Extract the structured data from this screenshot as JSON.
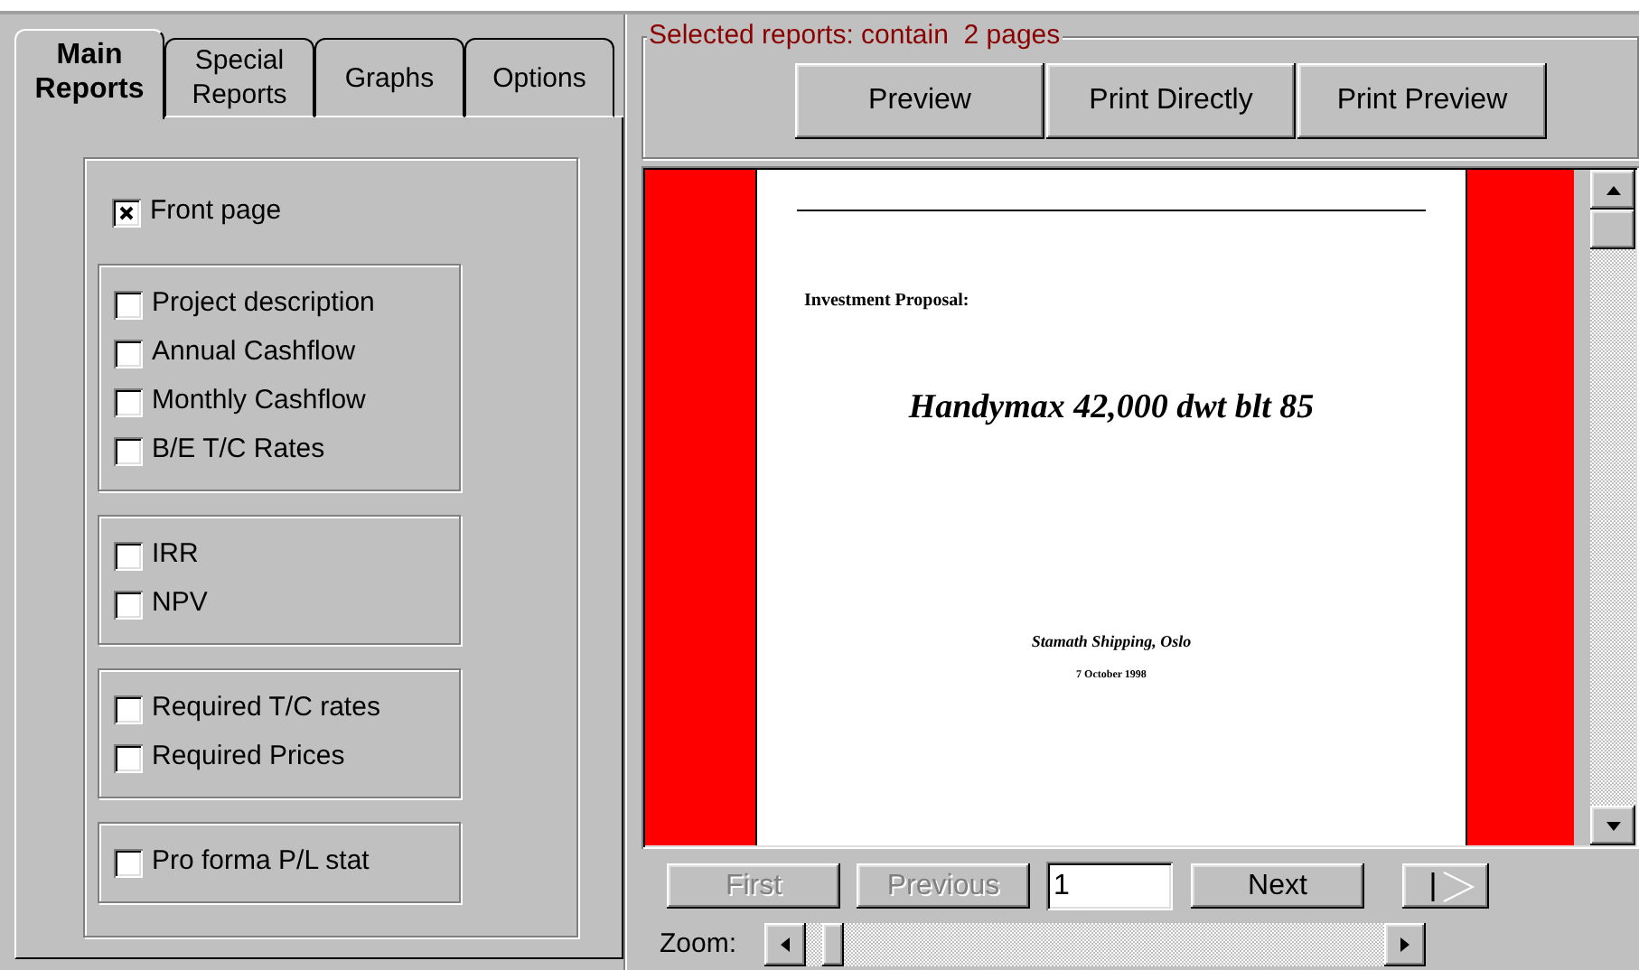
{
  "tabs": [
    {
      "label": "Main Reports",
      "selected": true
    },
    {
      "label": "Special Reports",
      "selected": false
    },
    {
      "label": "Graphs",
      "selected": false
    },
    {
      "label": "Options",
      "selected": false
    }
  ],
  "report_groups": [
    {
      "kind": "plain",
      "items": [
        {
          "label": "Front page",
          "checked": true
        }
      ]
    },
    {
      "kind": "boxed",
      "items": [
        {
          "label": "Project description",
          "checked": false
        },
        {
          "label": "Annual Cashflow",
          "checked": false
        },
        {
          "label": "Monthly Cashflow",
          "checked": false
        },
        {
          "label": "B/E T/C Rates",
          "checked": false
        }
      ]
    },
    {
      "kind": "boxed",
      "items": [
        {
          "label": "IRR",
          "checked": false
        },
        {
          "label": "NPV",
          "checked": false
        }
      ]
    },
    {
      "kind": "boxed",
      "items": [
        {
          "label": "Required T/C rates",
          "checked": false
        },
        {
          "label": "Required Prices",
          "checked": false
        }
      ]
    },
    {
      "kind": "boxed",
      "items": [
        {
          "label": "Pro forma P/L stat",
          "checked": false
        }
      ]
    }
  ],
  "selection_summary": "Selected reports: contain  2 pages",
  "action_buttons": [
    "Preview",
    "Print Directly",
    "Print Preview"
  ],
  "preview_page": {
    "heading": "Investment Proposal:",
    "title": "Handymax 42,000 dwt blt 85",
    "company": "Stamath Shipping, Oslo",
    "date": "7 October 1998"
  },
  "navigation": {
    "buttons": [
      {
        "label": "First",
        "disabled": true
      },
      {
        "label": "Previous",
        "disabled": true
      }
    ],
    "page_field": {
      "value": "1"
    },
    "next": {
      "label": "Next",
      "disabled": false
    }
  },
  "zoom": {
    "label": "Zoom:",
    "level": 0.03
  }
}
